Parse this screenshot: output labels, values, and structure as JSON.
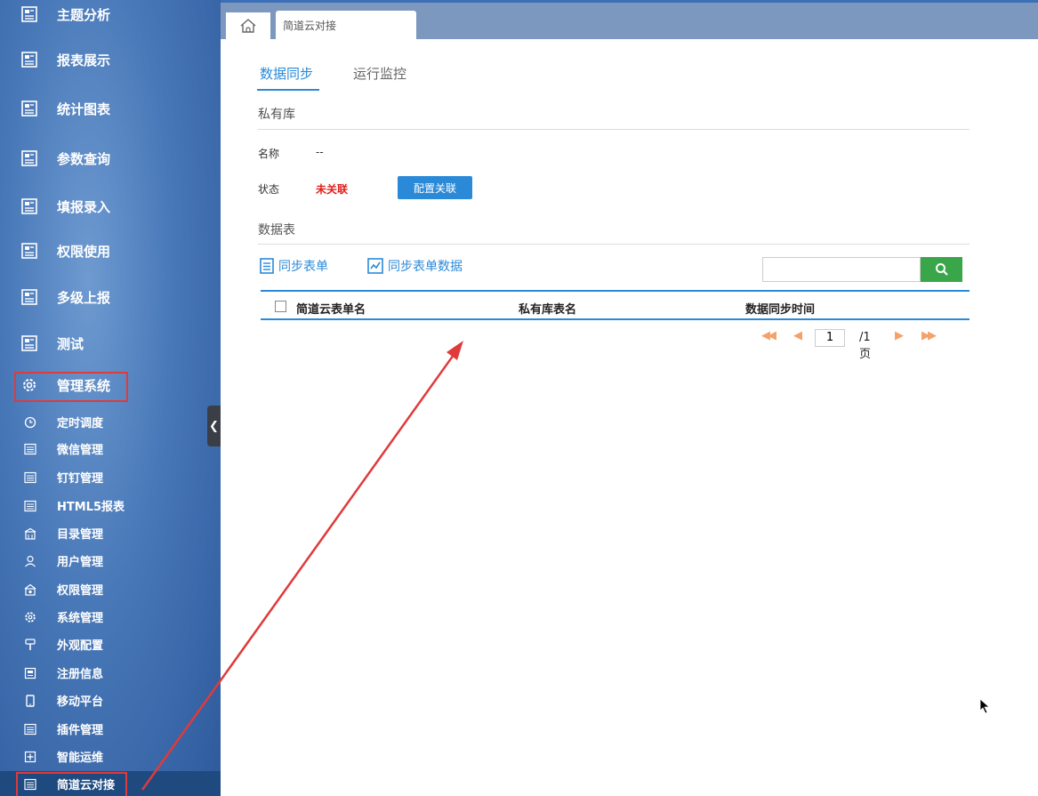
{
  "sidebar": {
    "items": [
      {
        "label": "主题分析",
        "icon": "report-icon"
      },
      {
        "label": "报表展示",
        "icon": "report-icon"
      },
      {
        "label": "统计图表",
        "icon": "report-icon"
      },
      {
        "label": "参数查询",
        "icon": "report-icon"
      },
      {
        "label": "填报录入",
        "icon": "report-icon"
      },
      {
        "label": "权限使用",
        "icon": "report-icon"
      },
      {
        "label": "多级上报",
        "icon": "report-icon"
      },
      {
        "label": "测试",
        "icon": "report-icon"
      },
      {
        "label": "管理系统",
        "icon": "gear-icon"
      }
    ],
    "subitems": [
      {
        "label": "定时调度",
        "icon": "clock-icon"
      },
      {
        "label": "微信管理",
        "icon": "grid-icon"
      },
      {
        "label": "钉钉管理",
        "icon": "grid-icon"
      },
      {
        "label": "HTML5报表",
        "icon": "grid-icon"
      },
      {
        "label": "目录管理",
        "icon": "building-icon"
      },
      {
        "label": "用户管理",
        "icon": "user-icon"
      },
      {
        "label": "权限管理",
        "icon": "lock-icon"
      },
      {
        "label": "系统管理",
        "icon": "settings-icon"
      },
      {
        "label": "外观配置",
        "icon": "brush-icon"
      },
      {
        "label": "注册信息",
        "icon": "register-icon"
      },
      {
        "label": "移动平台",
        "icon": "mobile-icon"
      },
      {
        "label": "插件管理",
        "icon": "grid-icon"
      },
      {
        "label": "智能运维",
        "icon": "plus-box-icon"
      },
      {
        "label": "简道云对接",
        "icon": "grid-icon"
      }
    ]
  },
  "tabs": {
    "page_tab": "简道云对接"
  },
  "content": {
    "tab_sync": "数据同步",
    "tab_monitor": "运行监控",
    "private_db_title": "私有库",
    "name_label": "名称",
    "name_value": "--",
    "status_label": "状态",
    "status_value": "未关联",
    "config_button": "配置关联",
    "data_table_title": "数据表",
    "sync_form_button": "同步表单",
    "sync_form_data_button": "同步表单数据",
    "search_placeholder": "",
    "columns": [
      "简道云表单名",
      "私有库表名",
      "数据同步时间"
    ],
    "pager": {
      "current": "1",
      "total": "/1 页"
    }
  },
  "colors": {
    "accent": "#2b8ad8",
    "status_red": "#e0201c",
    "search_green": "#3aa64a",
    "highlight_red": "#e03a3a"
  }
}
